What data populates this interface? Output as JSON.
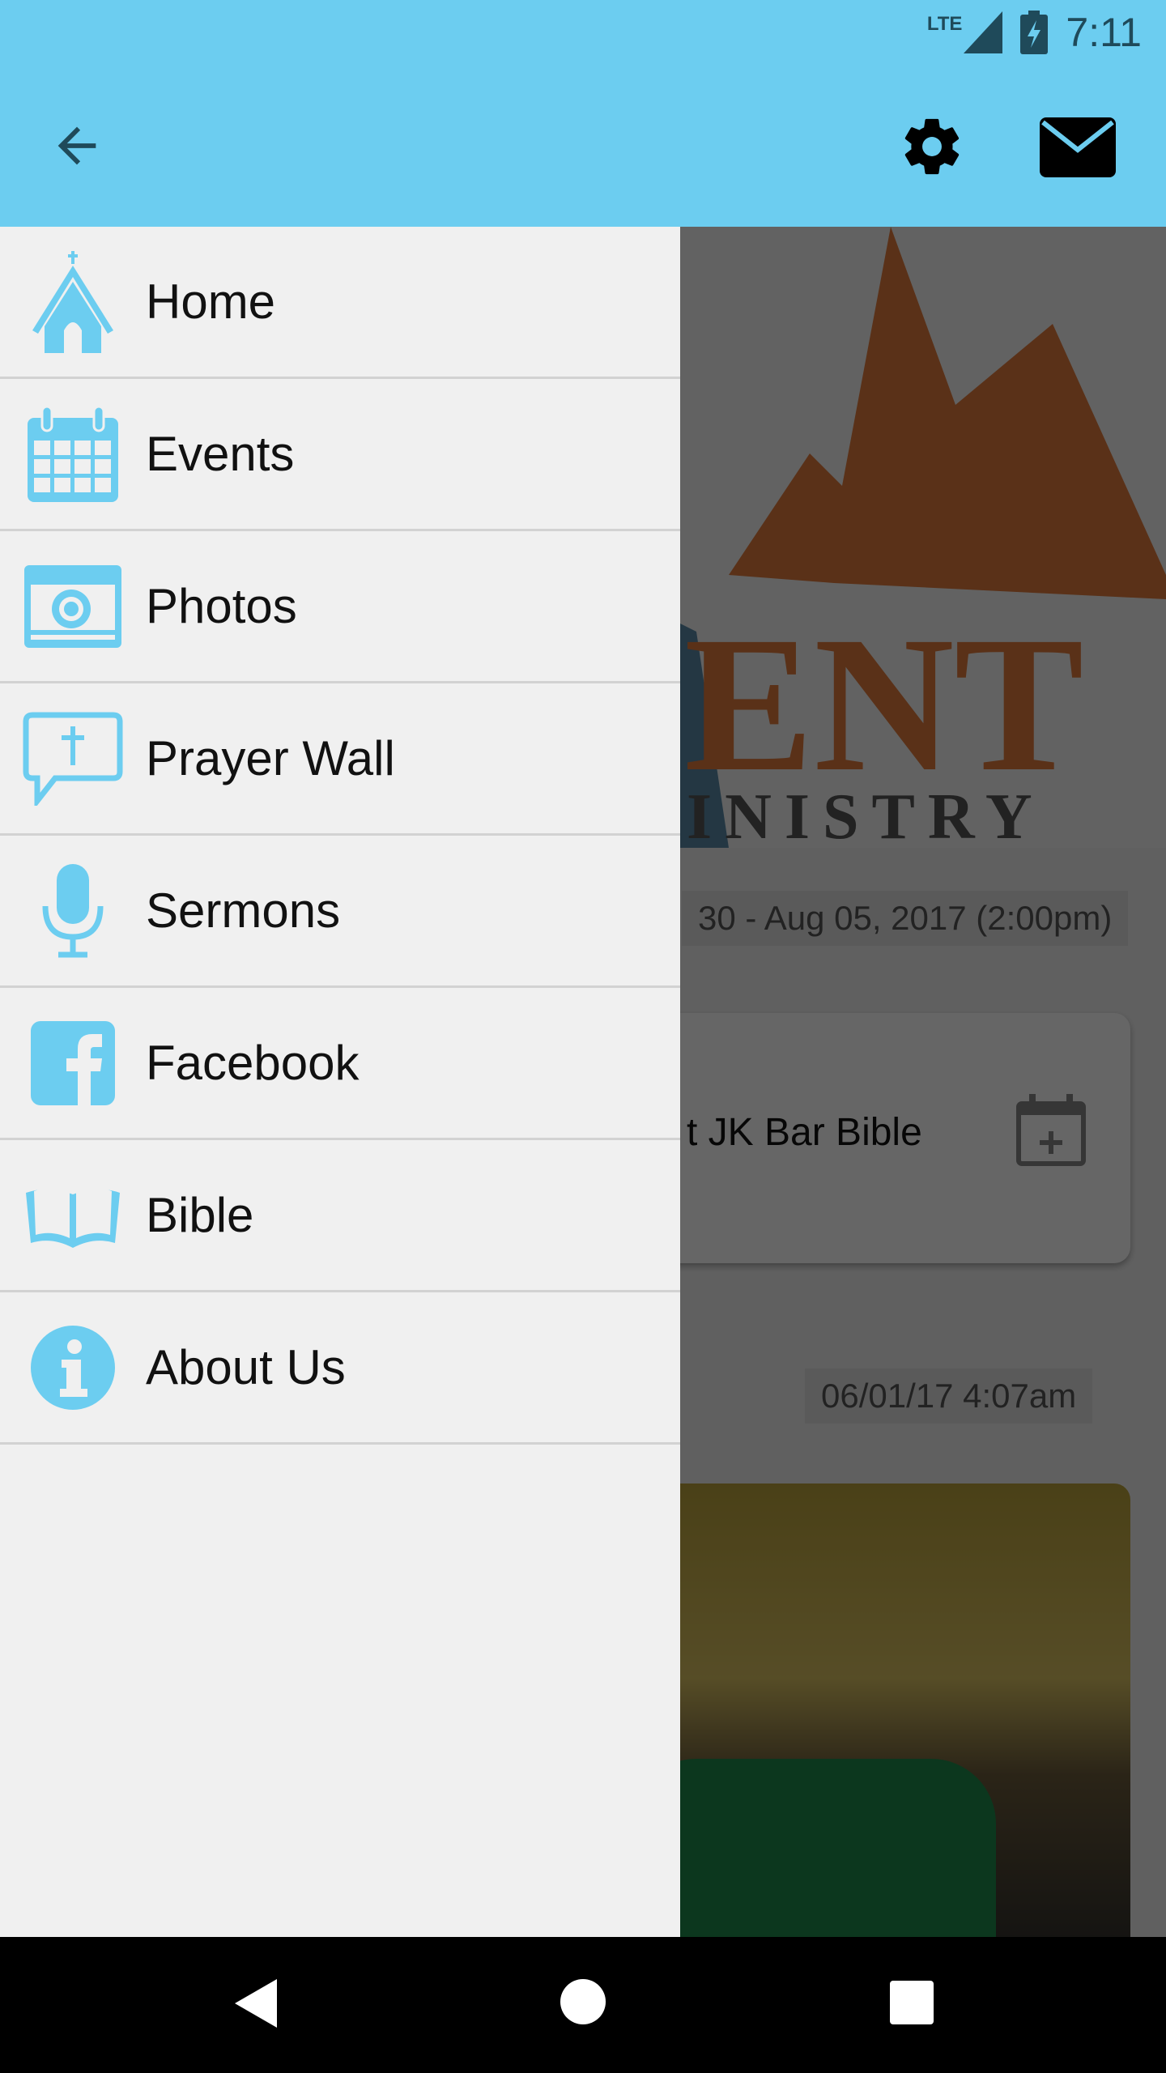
{
  "status_bar": {
    "network": "LTE",
    "time": "7:11"
  },
  "toolbar": {
    "back_icon": "arrow-back-icon",
    "settings_icon": "gear-icon",
    "mail_icon": "envelope-icon"
  },
  "drawer": {
    "items": [
      {
        "label": "Home",
        "icon": "church-icon"
      },
      {
        "label": "Events",
        "icon": "calendar-icon"
      },
      {
        "label": "Photos",
        "icon": "camera-icon"
      },
      {
        "label": "Prayer Wall",
        "icon": "speech-bubble-cross-icon"
      },
      {
        "label": "Sermons",
        "icon": "microphone-icon"
      },
      {
        "label": "Facebook",
        "icon": "facebook-icon"
      },
      {
        "label": "Bible",
        "icon": "open-book-icon"
      },
      {
        "label": "About Us",
        "icon": "info-icon"
      }
    ]
  },
  "background": {
    "logo_text": [
      "ENT",
      "INISTRY"
    ],
    "event_date": "30 - Aug 05, 2017 (2:00pm)",
    "event_title": "t JK Bar Bible",
    "post_timestamp": "06/01/17 4:07am"
  },
  "colors": {
    "accent": "#6ccdf0",
    "drawer_bg": "#f0f0f0",
    "logo_orange": "#e07a3c"
  }
}
